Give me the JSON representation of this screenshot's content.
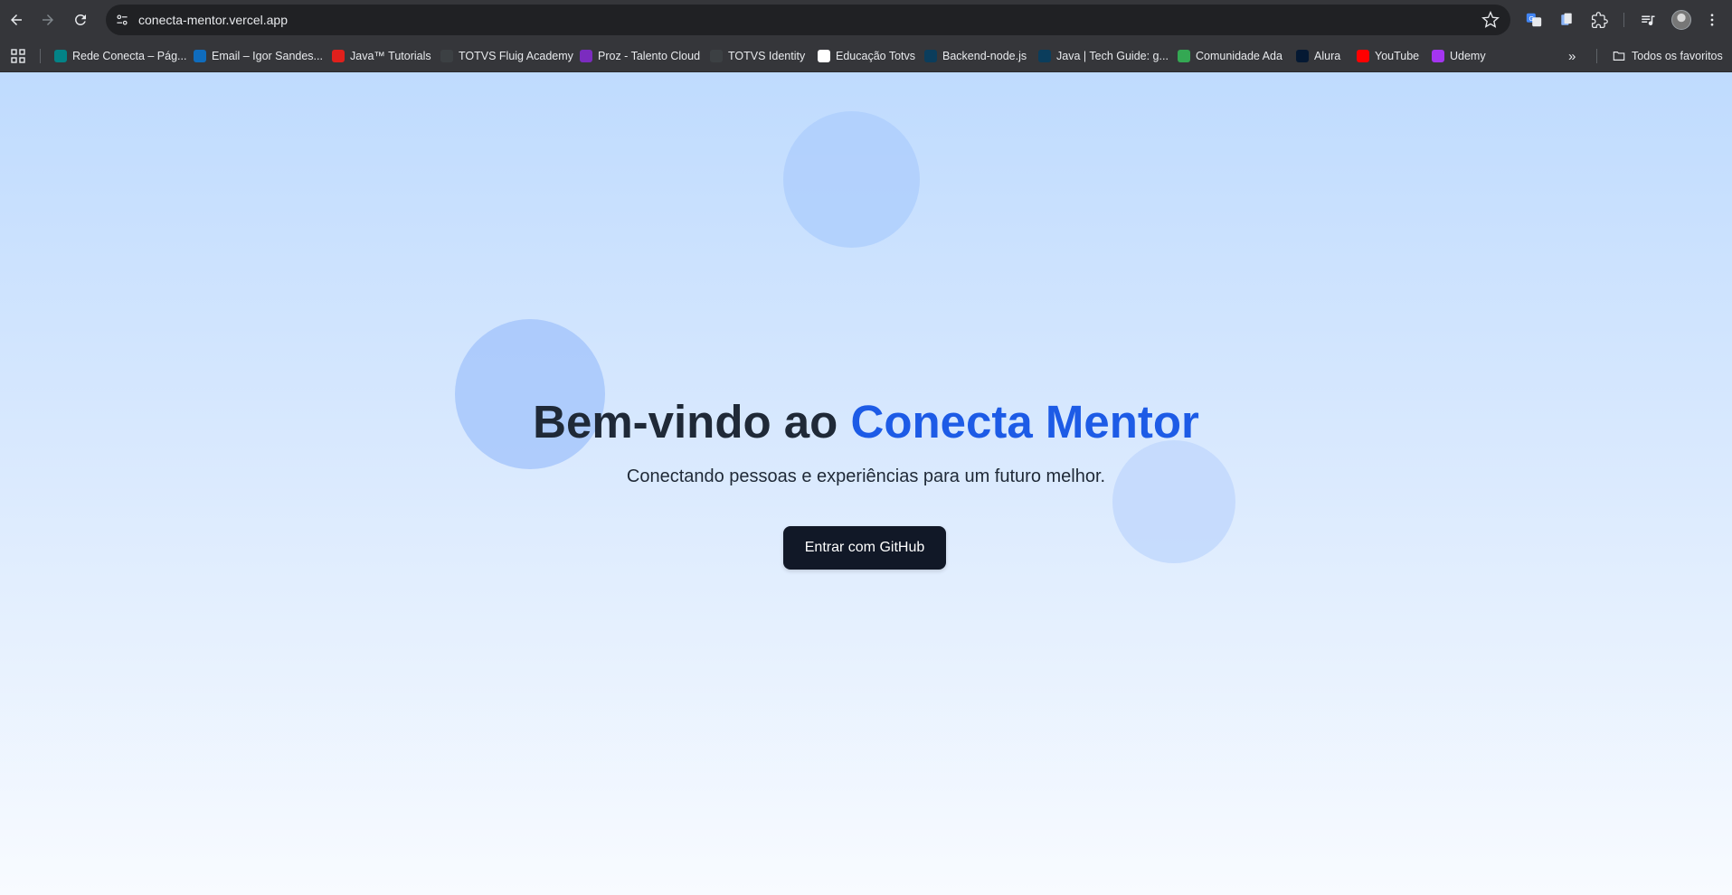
{
  "browser": {
    "url": "conecta-mentor.vercel.app",
    "bookmarks": [
      {
        "label": "Rede Conecta – Pág...",
        "icon": "sharepoint-icon",
        "color": "#038387"
      },
      {
        "label": "Email – Igor Sandes...",
        "icon": "outlook-icon",
        "color": "#0f6cbd"
      },
      {
        "label": "Java™ Tutorials",
        "icon": "oracle-icon",
        "color": "#e0201c"
      },
      {
        "label": "TOTVS Fluig Academy",
        "icon": "totvs-icon",
        "color": "#3c4043"
      },
      {
        "label": "Proz - Talento Cloud",
        "icon": "proz-icon",
        "color": "#7b2cbf"
      },
      {
        "label": "TOTVS Identity",
        "icon": "totvs-identity-icon",
        "color": "#3c4043"
      },
      {
        "label": "Educação Totvs",
        "icon": "educacao-icon",
        "color": "#ffffff"
      },
      {
        "label": "Backend-node.js",
        "icon": "t-icon",
        "color": "#0b3d5c"
      },
      {
        "label": "Java | Tech Guide: g...",
        "icon": "t-icon",
        "color": "#0b3d5c"
      },
      {
        "label": "Comunidade Ada",
        "icon": "ada-icon",
        "color": "#34a853"
      },
      {
        "label": "Alura",
        "icon": "alura-icon",
        "color": "#051933"
      },
      {
        "label": "YouTube",
        "icon": "youtube-icon",
        "color": "#ff0000"
      },
      {
        "label": "Udemy",
        "icon": "udemy-icon",
        "color": "#a435f0"
      }
    ],
    "all_bookmarks_label": "Todos os favoritos"
  },
  "hero": {
    "title_prefix": "Bem-vindo ao",
    "title_accent": "Conecta Mentor",
    "subtitle": "Conectando pessoas e experiências para um futuro melhor.",
    "button_label": "Entrar com GitHub"
  },
  "colors": {
    "accent": "#1d5be6",
    "button_bg": "#111827",
    "text": "#1f2937"
  }
}
